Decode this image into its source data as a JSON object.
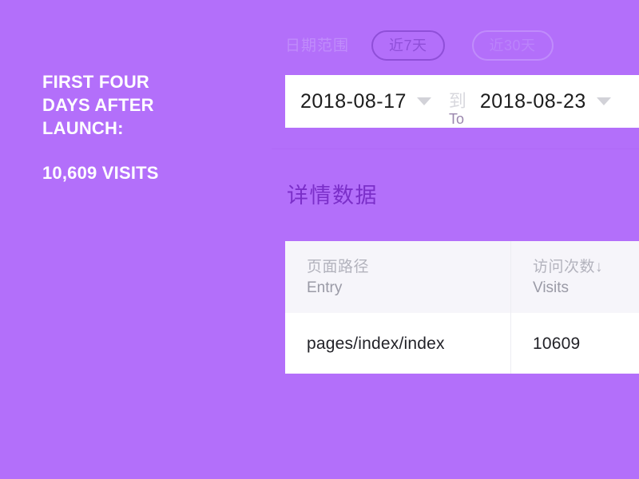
{
  "background_color": "#b36ffa",
  "headline": {
    "lines": [
      "First four",
      "days after",
      "launch:"
    ],
    "stat": "10,609 visits"
  },
  "date_range": {
    "label": "日期范围",
    "presets": [
      {
        "label": "近7天",
        "selected": true
      },
      {
        "label": "近30天",
        "selected": false
      }
    ],
    "start_date": "2018-08-17",
    "end_date": "2018-08-23",
    "separator_cn": "到",
    "separator_en": "To",
    "caret_icon": "chevron-down-icon",
    "selected_color": "#8f4fd8",
    "idle_color": "#c08cfb"
  },
  "detail_section": {
    "title": "详情数据",
    "title_color": "#7b2fc9",
    "table": {
      "columns": [
        {
          "cn": "页面路径",
          "en": "Entry",
          "sort": ""
        },
        {
          "cn": "访问次数↓",
          "en": "Visits",
          "sort": "desc"
        }
      ],
      "rows": [
        {
          "entry": "pages/index/index",
          "visits": "10609"
        }
      ]
    }
  }
}
